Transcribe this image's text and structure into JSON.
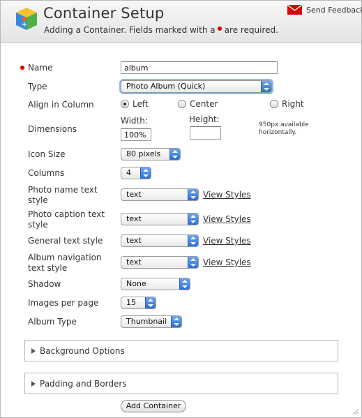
{
  "header": {
    "title": "Container Setup",
    "subtitle_before": "Adding a Container. Fields marked with a",
    "subtitle_after": "are required.",
    "feedback_label": "Send Feedback"
  },
  "form": {
    "name": {
      "label": "Name",
      "value": "album",
      "required": true
    },
    "type": {
      "label": "Type",
      "selected": "Photo Album (Quick)"
    },
    "align": {
      "label": "Align in Column",
      "options": [
        "Left",
        "Center",
        "Right"
      ],
      "selected": "Left"
    },
    "dimensions": {
      "label": "Dimensions",
      "width_label": "Width:",
      "width_value": "100%",
      "height_label": "Height:",
      "height_value": "",
      "note_line1": "950px available",
      "note_line2": "horizontally."
    },
    "icon_size": {
      "label": "Icon Size",
      "selected": "80 pixels"
    },
    "columns": {
      "label": "Columns",
      "selected": "4"
    },
    "photo_name_style": {
      "label_line1": "Photo name text",
      "label_line2": "style",
      "selected": "text",
      "link": "View Styles"
    },
    "photo_caption_style": {
      "label_line1": "Photo caption text",
      "label_line2": "style",
      "selected": "text",
      "link": "View Styles"
    },
    "general_text_style": {
      "label": "General text style",
      "selected": "text",
      "link": "View Styles"
    },
    "album_nav_style": {
      "label_line1": "Album navigation",
      "label_line2": "text style",
      "selected": "text",
      "link": "View Styles"
    },
    "shadow": {
      "label": "Shadow",
      "selected": "None"
    },
    "images_per_page": {
      "label": "Images per page",
      "selected": "15"
    },
    "album_type": {
      "label": "Album Type",
      "selected": "Thumbnail"
    }
  },
  "sections": {
    "background": "Background Options",
    "padding": "Padding and Borders"
  },
  "actions": {
    "add_container": "Add Container"
  },
  "colors": {
    "required": "#d40000",
    "select_arrow": "#2b6fd6"
  }
}
